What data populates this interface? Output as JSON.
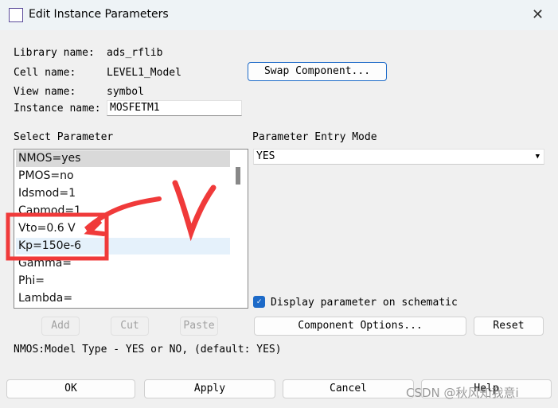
{
  "window": {
    "title": "Edit Instance Parameters",
    "close": "✕"
  },
  "info": {
    "library_label": "Library name:",
    "library": "ads_rflib",
    "cell_label": "Cell name:",
    "cell": "LEVEL1_Model",
    "view_label": "View name:",
    "view": "symbol",
    "instance_label": "Instance name:",
    "instance": "MOSFETM1"
  },
  "swap_label": "Swap Component...",
  "select_param_label": "Select Parameter",
  "params": [
    "NMOS=yes",
    "PMOS=no",
    "Idsmod=1",
    "Capmod=1",
    "Vto=0.6 V",
    "Kp=150e-6",
    "Gamma=",
    "Phi=",
    "Lambda="
  ],
  "entry_mode": {
    "label": "Parameter Entry Mode",
    "value": "YES"
  },
  "display_param": {
    "label": "Display parameter on schematic",
    "checked": true
  },
  "buttons": {
    "add": "Add",
    "cut": "Cut",
    "paste": "Paste",
    "component_options": "Component Options...",
    "reset": "Reset",
    "ok": "OK",
    "apply": "Apply",
    "cancel": "Cancel",
    "help": "Help"
  },
  "description": "NMOS:Model Type - YES or NO, (default: YES)",
  "annotation": {
    "letter": "V",
    "color": "#f03a3a"
  },
  "watermark": "CSDN @秋风知我意i"
}
